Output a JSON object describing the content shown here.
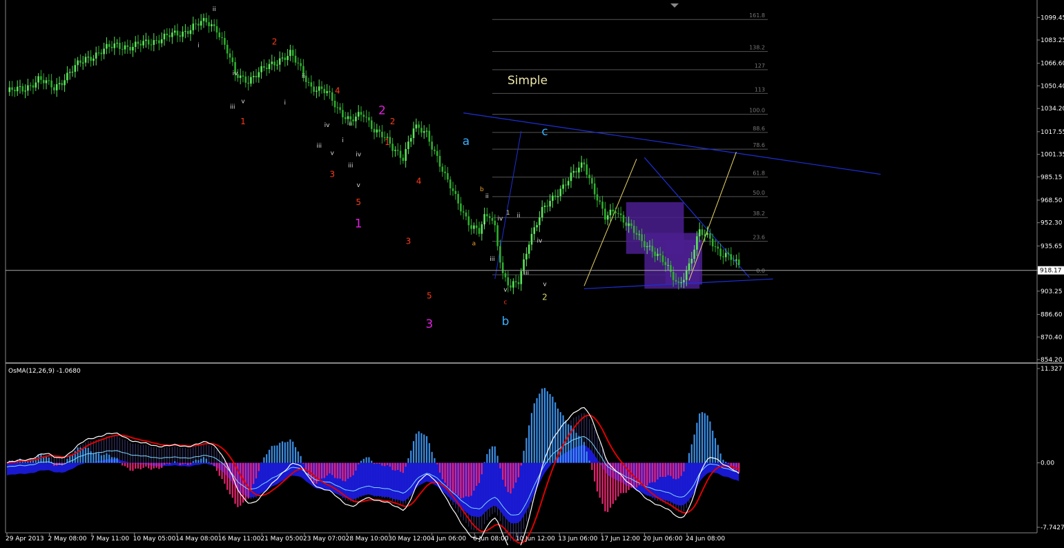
{
  "colors": {
    "background": "#000000",
    "bull_candle": "#5CE65C",
    "bear_candle": "#2FAF2F",
    "trendline": "#1E2FD8",
    "fib": "#555555",
    "box": "#4B1E8F",
    "hist_pos": "#3A8EE6",
    "hist_neg": "#E6246E",
    "area_blue": "#1A1ADB",
    "signal_red": "#E00000",
    "macd_white": "#FFFFFF"
  },
  "chart_data": [
    {
      "type": "candlestick",
      "title": "",
      "annotation_text": "Simple",
      "ylim": [
        854.2,
        1107.0
      ],
      "ytick_labels": [
        "1099.45",
        "1083.25",
        "1066.60",
        "1050.40",
        "1034.20",
        "1017.55",
        "1001.35",
        "985.15",
        "968.50",
        "952.30",
        "935.65",
        "918.17",
        "903.25",
        "886.60",
        "870.40",
        "854.20"
      ],
      "current_price": "918.17",
      "x_tick_labels": [
        "29 Apr 2013",
        "2 May 08:00",
        "7 May 11:00",
        "10 May 05:00",
        "14 May 08:00",
        "16 May 11:00",
        "21 May 05:00",
        "23 May 07:00",
        "28 May 10:00",
        "30 May 12:00",
        "4 Jun 06:00",
        "6 Jun 08:00",
        "10 Jun 12:00",
        "13 Jun 06:00",
        "17 Jun 12:00",
        "20 Jun 06:00",
        "24 Jun 08:00"
      ],
      "price_path": [
        [
          0,
          1046
        ],
        [
          6,
          1048
        ],
        [
          12,
          1055
        ],
        [
          18,
          1049
        ],
        [
          24,
          1060
        ],
        [
          30,
          1070
        ],
        [
          36,
          1075
        ],
        [
          42,
          1080
        ],
        [
          48,
          1078
        ],
        [
          54,
          1082
        ],
        [
          60,
          1085
        ],
        [
          66,
          1088
        ],
        [
          72,
          1094
        ],
        [
          76,
          1096
        ],
        [
          80,
          1092
        ],
        [
          84,
          1075
        ],
        [
          87,
          1058
        ],
        [
          92,
          1055
        ],
        [
          98,
          1062
        ],
        [
          104,
          1070
        ],
        [
          108,
          1073
        ],
        [
          111,
          1065
        ],
        [
          116,
          1050
        ],
        [
          122,
          1045
        ],
        [
          126,
          1035
        ],
        [
          131,
          1025
        ],
        [
          136,
          1030
        ],
        [
          140,
          1020
        ],
        [
          143,
          1015
        ],
        [
          147,
          1005
        ],
        [
          151,
          1000
        ],
        [
          155,
          1020
        ],
        [
          160,
          1016
        ],
        [
          164,
          1000
        ],
        [
          167,
          985
        ],
        [
          171,
          970
        ],
        [
          174,
          960
        ],
        [
          177,
          950
        ],
        [
          180,
          945
        ],
        [
          182,
          955
        ],
        [
          184,
          958
        ],
        [
          186,
          950
        ],
        [
          189,
          915
        ],
        [
          192,
          905
        ],
        [
          195,
          910
        ],
        [
          199,
          940
        ],
        [
          204,
          960
        ],
        [
          210,
          975
        ],
        [
          215,
          985
        ],
        [
          220,
          995
        ],
        [
          225,
          970
        ],
        [
          228,
          955
        ],
        [
          232,
          962
        ],
        [
          235,
          955
        ],
        [
          238,
          948
        ],
        [
          242,
          938
        ],
        [
          246,
          934
        ],
        [
          250,
          925
        ],
        [
          253,
          915
        ],
        [
          256,
          908
        ],
        [
          260,
          922
        ],
        [
          264,
          945
        ],
        [
          268,
          942
        ],
        [
          272,
          930
        ],
        [
          276,
          926
        ],
        [
          279,
          922
        ]
      ],
      "fib_levels": [
        {
          "label": "161.8",
          "value": 1098.0
        },
        {
          "label": "138.2",
          "value": 1075.0
        },
        {
          "label": "127",
          "value": 1062.0
        },
        {
          "label": "113",
          "value": 1045.0
        },
        {
          "label": "100.0",
          "value": 1030.0
        },
        {
          "label": "88.6",
          "value": 1017.0
        },
        {
          "label": "78.6",
          "value": 1005.0
        },
        {
          "label": "61.8",
          "value": 985.0
        },
        {
          "label": "50.0",
          "value": 971.0
        },
        {
          "label": "38.2",
          "value": 956.0
        },
        {
          "label": "23.6",
          "value": 939.0
        },
        {
          "label": "0.0",
          "value": 915.0
        }
      ],
      "wave_labels": [
        {
          "text": "ii",
          "i": 79,
          "price": 1104,
          "color": "#DDDDDD",
          "size": "s"
        },
        {
          "text": "i",
          "i": 73,
          "price": 1078,
          "color": "#DDDDDD",
          "size": "s"
        },
        {
          "text": "iv",
          "i": 87,
          "price": 1058,
          "color": "#DDDDDD",
          "size": "s"
        },
        {
          "text": "iii",
          "i": 86,
          "price": 1034,
          "color": "#DDDDDD",
          "size": "s"
        },
        {
          "text": "v",
          "i": 90,
          "price": 1038,
          "color": "#DDDDDD",
          "size": "s"
        },
        {
          "text": "1",
          "i": 90,
          "price": 1023,
          "color": "#FF3A1A",
          "size": "m"
        },
        {
          "text": "2",
          "i": 102,
          "price": 1080,
          "color": "#FF3A1A",
          "size": "m"
        },
        {
          "text": "ii",
          "i": 113,
          "price": 1056,
          "color": "#DDDDDD",
          "size": "s"
        },
        {
          "text": "i",
          "i": 106,
          "price": 1037,
          "color": "#DDDDDD",
          "size": "s"
        },
        {
          "text": "iv",
          "i": 122,
          "price": 1021,
          "color": "#DDDDDD",
          "size": "s"
        },
        {
          "text": "iii",
          "i": 119,
          "price": 1006,
          "color": "#DDDDDD",
          "size": "s"
        },
        {
          "text": "v",
          "i": 124,
          "price": 1001,
          "color": "#DDDDDD",
          "size": "s"
        },
        {
          "text": "3",
          "i": 124,
          "price": 985,
          "color": "#FF3A1A",
          "size": "m"
        },
        {
          "text": "4",
          "i": 126,
          "price": 1045,
          "color": "#FF3A1A",
          "size": "m"
        },
        {
          "text": "ii",
          "i": 131,
          "price": 1022,
          "color": "#DDDDDD",
          "size": "s"
        },
        {
          "text": "i",
          "i": 128,
          "price": 1010,
          "color": "#DDDDDD",
          "size": "s"
        },
        {
          "text": "iv",
          "i": 134,
          "price": 1000,
          "color": "#DDDDDD",
          "size": "s"
        },
        {
          "text": "iii",
          "i": 131,
          "price": 992,
          "color": "#DDDDDD",
          "size": "s"
        },
        {
          "text": "v",
          "i": 134,
          "price": 978,
          "color": "#DDDDDD",
          "size": "s"
        },
        {
          "text": "5",
          "i": 134,
          "price": 965,
          "color": "#FF3A1A",
          "size": "m"
        },
        {
          "text": "1",
          "i": 134,
          "price": 949,
          "color": "#E020E0",
          "size": "l"
        },
        {
          "text": "2",
          "i": 143,
          "price": 1030,
          "color": "#E020E0",
          "size": "l"
        },
        {
          "text": "2",
          "i": 147,
          "price": 1023,
          "color": "#FF3A1A",
          "size": "m"
        },
        {
          "text": "1",
          "i": 145,
          "price": 1008,
          "color": "#FF3A1A",
          "size": "m"
        },
        {
          "text": "4",
          "i": 157,
          "price": 980,
          "color": "#FF3A1A",
          "size": "m"
        },
        {
          "text": "3",
          "i": 153,
          "price": 937,
          "color": "#FF3A1A",
          "size": "m"
        },
        {
          "text": "5",
          "i": 161,
          "price": 898,
          "color": "#FF3A1A",
          "size": "m"
        },
        {
          "text": "3",
          "i": 161,
          "price": 877,
          "color": "#E020E0",
          "size": "l"
        },
        {
          "text": "a",
          "i": 175,
          "price": 1008,
          "color": "#3AB0FF",
          "size": "l"
        },
        {
          "text": "b",
          "i": 181,
          "price": 975,
          "color": "#E8A02A",
          "size": "s"
        },
        {
          "text": "ii",
          "i": 183,
          "price": 970,
          "color": "#DDDDDD",
          "size": "s"
        },
        {
          "text": "i",
          "i": 182,
          "price": 950,
          "color": "#DDDDDD",
          "size": "s"
        },
        {
          "text": "a",
          "i": 178,
          "price": 936,
          "color": "#E8A02A",
          "size": "s"
        },
        {
          "text": "iv",
          "i": 188,
          "price": 954,
          "color": "#DDDDDD",
          "size": "s"
        },
        {
          "text": "iii",
          "i": 185,
          "price": 925,
          "color": "#DDDDDD",
          "size": "s"
        },
        {
          "text": "1",
          "i": 191,
          "price": 958,
          "color": "#D8D86A",
          "size": "s"
        },
        {
          "text": "ii",
          "i": 195,
          "price": 956,
          "color": "#DDDDDD",
          "size": "s"
        },
        {
          "text": "v",
          "i": 190,
          "price": 903,
          "color": "#DDDDDD",
          "size": "s"
        },
        {
          "text": "c",
          "i": 190,
          "price": 894,
          "color": "#FF3A1A",
          "size": "s"
        },
        {
          "text": "b",
          "i": 190,
          "price": 879,
          "color": "#3AB0FF",
          "size": "l"
        },
        {
          "text": "iv",
          "i": 203,
          "price": 938,
          "color": "#DDDDDD",
          "size": "s"
        },
        {
          "text": "iii",
          "i": 198,
          "price": 915,
          "color": "#DDDDDD",
          "size": "s"
        },
        {
          "text": "v",
          "i": 205,
          "price": 907,
          "color": "#DDDDDD",
          "size": "s"
        },
        {
          "text": "2",
          "i": 205,
          "price": 897,
          "color": "#D8D86A",
          "size": "m"
        },
        {
          "text": "c",
          "i": 205,
          "price": 1015,
          "color": "#3AB0FF",
          "size": "l"
        }
      ]
    },
    {
      "type": "osma",
      "title": "OsMA(12,26,9) -1.0680",
      "ylim": [
        -7.7427,
        11.327
      ],
      "ytick_labels": [
        "11.327",
        "0.00",
        "-7.7427"
      ]
    }
  ]
}
